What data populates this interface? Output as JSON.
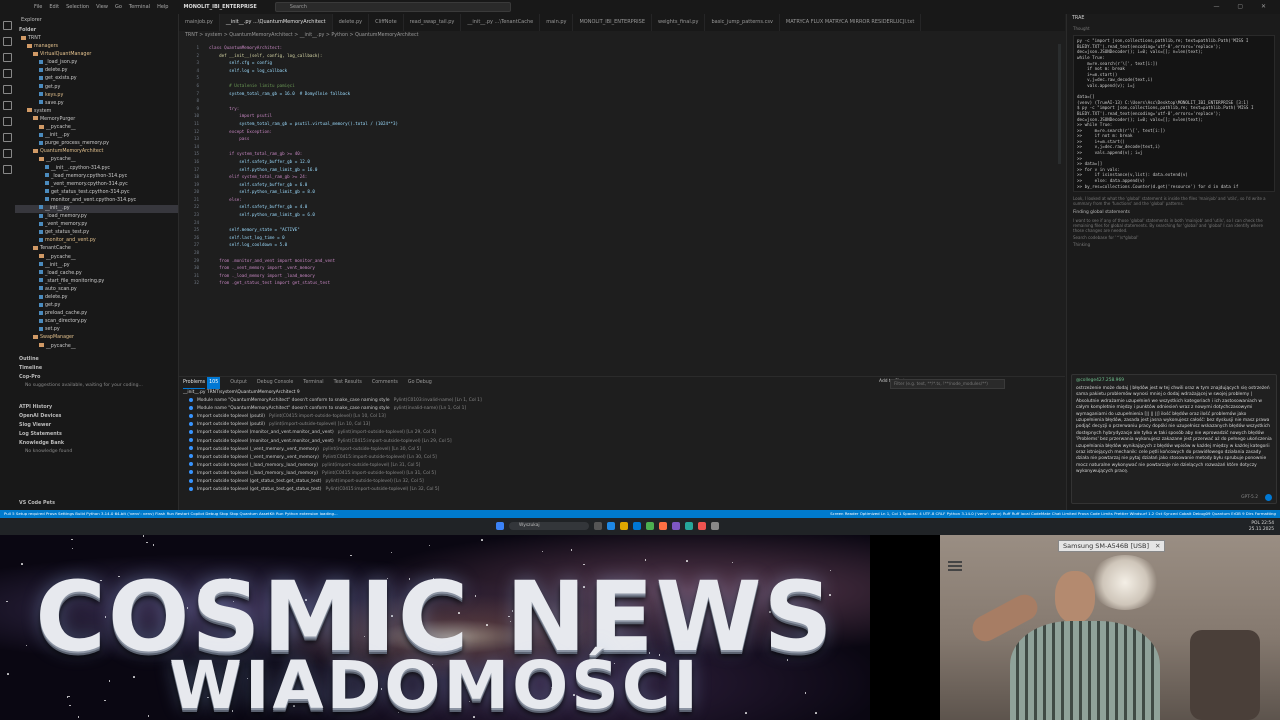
{
  "titlebar": {
    "menu": [
      "File",
      "Edit",
      "Selection",
      "View",
      "Go",
      "Terminal",
      "Help"
    ],
    "title": "MONOLIT_IBI_ENTERPRISE",
    "search_placeholder": "Search"
  },
  "sidebar": {
    "header": "Explorer",
    "folder_label": "Folder",
    "tree": [
      {
        "label": "TRNT",
        "kind": "folder",
        "depth": 0
      },
      {
        "label": "managers",
        "kind": "folder",
        "depth": 1,
        "mod": true
      },
      {
        "label": "VirtualQuantManager",
        "kind": "folder",
        "depth": 2,
        "mod": true
      },
      {
        "label": "_load_json.py",
        "kind": "file",
        "depth": 3
      },
      {
        "label": "delete.py",
        "kind": "file",
        "depth": 3
      },
      {
        "label": "get_exists.py",
        "kind": "file",
        "depth": 3
      },
      {
        "label": "get.py",
        "kind": "file",
        "depth": 3
      },
      {
        "label": "keys.py",
        "kind": "file",
        "depth": 3,
        "mod": true
      },
      {
        "label": "save.py",
        "kind": "file",
        "depth": 3
      },
      {
        "label": "system",
        "kind": "folder",
        "depth": 1
      },
      {
        "label": "MemoryPurger",
        "kind": "folder",
        "depth": 2
      },
      {
        "label": "__pycache__",
        "kind": "folder",
        "depth": 3
      },
      {
        "label": "__init__.py",
        "kind": "file",
        "depth": 3
      },
      {
        "label": "purge_process_memory.py",
        "kind": "file",
        "depth": 3
      },
      {
        "label": "QuantumMemoryArchitect",
        "kind": "folder",
        "depth": 2,
        "mod": true
      },
      {
        "label": "__pycache__",
        "kind": "folder",
        "depth": 3
      },
      {
        "label": "__init__.cpython-314.pyc",
        "kind": "file",
        "depth": 4
      },
      {
        "label": "_load_memory.cpython-314.pyc",
        "kind": "file",
        "depth": 4
      },
      {
        "label": "_vent_memory.cpython-314.pyc",
        "kind": "file",
        "depth": 4
      },
      {
        "label": "get_status_test.cpython-314.pyc",
        "kind": "file",
        "depth": 4
      },
      {
        "label": "monitor_and_vent.cpython-314.pyc",
        "kind": "file",
        "depth": 4
      },
      {
        "label": "__init__.py",
        "kind": "file",
        "depth": 3,
        "sel": true
      },
      {
        "label": "_load_memory.py",
        "kind": "file",
        "depth": 3
      },
      {
        "label": "_vent_memory.py",
        "kind": "file",
        "depth": 3
      },
      {
        "label": "get_status_test.py",
        "kind": "file",
        "depth": 3
      },
      {
        "label": "monitor_and_vent.py",
        "kind": "file",
        "depth": 3,
        "mod": true
      },
      {
        "label": "TenantCache",
        "kind": "folder",
        "depth": 2
      },
      {
        "label": "__pycache__",
        "kind": "folder",
        "depth": 3
      },
      {
        "label": "__init__.py",
        "kind": "file",
        "depth": 3
      },
      {
        "label": "_load_cache.py",
        "kind": "file",
        "depth": 3
      },
      {
        "label": "_start_file_monitoring.py",
        "kind": "file",
        "depth": 3
      },
      {
        "label": "auto_scan.py",
        "kind": "file",
        "depth": 3
      },
      {
        "label": "delete.py",
        "kind": "file",
        "depth": 3
      },
      {
        "label": "get.py",
        "kind": "file",
        "depth": 3
      },
      {
        "label": "preload_cache.py",
        "kind": "file",
        "depth": 3
      },
      {
        "label": "scan_directory.py",
        "kind": "file",
        "depth": 3
      },
      {
        "label": "set.py",
        "kind": "file",
        "depth": 3
      },
      {
        "label": "SwapManager",
        "kind": "folder",
        "depth": 2,
        "mod": true
      },
      {
        "label": "__pycache__",
        "kind": "folder",
        "depth": 3
      }
    ],
    "sections": {
      "outline": "Outline",
      "timeline": "Timeline",
      "copilot": "Cop-Pro",
      "copilot_msg": "No suggestions available, waiting for your coding...",
      "atpi_history": "ATPI History",
      "openai_devices": "OpenAI Devices",
      "slog_viewer": "Slog Viewer",
      "log_statements": "Log Statements",
      "knowledge_bank": "Knowledge Bank",
      "knowledge_msg": "No knowledge found",
      "code_pets": "VS Code Pets"
    }
  },
  "editor": {
    "tabs": [
      {
        "label": "mainjob.py",
        "active": false
      },
      {
        "label": "__init__.py   ...\\QuantumMemoryArchitect",
        "active": true
      },
      {
        "label": "delete.py",
        "active": false
      },
      {
        "label": "CliffNote",
        "active": false
      },
      {
        "label": "read_swap_tail.py",
        "active": false
      },
      {
        "label": "__init__.py   ...\\TenantCache",
        "active": false
      },
      {
        "label": "main.py",
        "active": false
      },
      {
        "label": "MONOLIT_IBI_ENTERPRISE",
        "active": false
      },
      {
        "label": "weights_final.py",
        "active": false
      },
      {
        "label": "basic_jump_patterns.csv",
        "active": false
      },
      {
        "label": "MATRYCA FLUX MATRYCA MIRROR RESIDERLUCJI.txt",
        "active": false
      }
    ],
    "breadcrumb": "TRNT > system > QuantumMemoryArchitect > __init__.py > Python > QuantumMemoryArchitect",
    "line_numbers": [
      "1",
      "2",
      "3",
      "4",
      "5",
      "6",
      "7",
      "8",
      "9",
      "10",
      "11",
      "12",
      "13",
      "14",
      "15",
      "16",
      "17",
      "18",
      "19",
      "20",
      "21",
      "22",
      "23",
      "24",
      "25",
      "26",
      "27",
      "28",
      "29",
      "30",
      "31",
      "32",
      "33",
      "34",
      "35",
      "36",
      "37"
    ],
    "code_lines": [
      {
        "text": "class QuantumMemoryArchitect:",
        "cls": "kw"
      },
      {
        "text": "    def __init__(self, config, log_callback):",
        "cls": "fn"
      },
      {
        "text": "        self.cfg = config",
        "cls": ""
      },
      {
        "text": "        self.log = log_callback",
        "cls": ""
      },
      {
        "text": "",
        "cls": ""
      },
      {
        "text": "        # Ustalenie limitu pamięci",
        "cls": "cm"
      },
      {
        "text": "        system_total_ram_gb = 16.0  # Domyślnie fallback",
        "cls": ""
      },
      {
        "text": "",
        "cls": ""
      },
      {
        "text": "        try:",
        "cls": "kw"
      },
      {
        "text": "            import psutil",
        "cls": "kw"
      },
      {
        "text": "            system_total_ram_gb = psutil.virtual_memory().total / (1024**3)",
        "cls": ""
      },
      {
        "text": "        except Exception:",
        "cls": "kw"
      },
      {
        "text": "            pass",
        "cls": "kw"
      },
      {
        "text": "",
        "cls": ""
      },
      {
        "text": "        if system_total_ram_gb >= 40:",
        "cls": "kw"
      },
      {
        "text": "            self.safety_buffer_gb = 12.0",
        "cls": ""
      },
      {
        "text": "            self.python_ram_limit_gb = 16.0",
        "cls": ""
      },
      {
        "text": "        elif system_total_ram_gb >= 24:",
        "cls": "kw"
      },
      {
        "text": "            self.safety_buffer_gb = 6.0",
        "cls": ""
      },
      {
        "text": "            self.python_ram_limit_gb = 8.0",
        "cls": ""
      },
      {
        "text": "        else:",
        "cls": "kw"
      },
      {
        "text": "            self.safety_buffer_gb = 4.0",
        "cls": ""
      },
      {
        "text": "            self.python_ram_limit_gb = 6.0",
        "cls": ""
      },
      {
        "text": "",
        "cls": ""
      },
      {
        "text": "        self.memory_state = \"ACTIVE\"",
        "cls": ""
      },
      {
        "text": "        self.last_log_time = 0",
        "cls": ""
      },
      {
        "text": "        self.log_cooldown = 5.0",
        "cls": ""
      },
      {
        "text": "",
        "cls": ""
      },
      {
        "text": "    from .monitor_and_vent import monitor_and_vent",
        "cls": "kw"
      },
      {
        "text": "    from ._vent_memory import _vent_memory",
        "cls": "kw"
      },
      {
        "text": "    from ._load_memory import _load_memory",
        "cls": "kw"
      },
      {
        "text": "    from .get_status_test import get_status_test",
        "cls": "kw"
      }
    ]
  },
  "panel": {
    "tabs": [
      "Problems",
      "Output",
      "Debug Console",
      "Terminal",
      "Test Results",
      "Comments",
      "Go Debug"
    ],
    "problems_count": "105",
    "add_to_chat": "Add to Chat",
    "filter_placeholder": "Filter (e.g. text, **/*.ts, !**/node_modules/**)",
    "rows": [
      {
        "kind": "file",
        "text": "__init__.py  TRNT\\system\\QuantumMemoryArchitect  9"
      },
      {
        "kind": "item",
        "text": "Module name \"QuantumMemoryArchitect\" doesn't conform to snake_case naming style",
        "src": "Pylint(C0103:invalid-name)  [Ln 1, Col 1]"
      },
      {
        "kind": "item",
        "text": "Module name \"QuantumMemoryArchitect\" doesn't conform to snake_case naming style",
        "src": "pylint(invalid-name)  [Ln 1, Col 1]"
      },
      {
        "kind": "item",
        "text": "Import outside toplevel (psutil)",
        "src": "Pylint(C0415:import-outside-toplevel)  [Ln 10, Col 13]"
      },
      {
        "kind": "item",
        "text": "Import outside toplevel (psutil)",
        "src": "pylint(import-outside-toplevel)  [Ln 10, Col 13]"
      },
      {
        "kind": "item",
        "text": "Import outside toplevel (monitor_and_vent.monitor_and_vent)",
        "src": "pylint(import-outside-toplevel)  [Ln 29, Col 5]"
      },
      {
        "kind": "item",
        "text": "Import outside toplevel (monitor_and_vent.monitor_and_vent)",
        "src": "Pylint(C0415:import-outside-toplevel)  [Ln 29, Col 5]"
      },
      {
        "kind": "item",
        "text": "Import outside toplevel (_vent_memory._vent_memory)",
        "src": "pylint(import-outside-toplevel)  [Ln 30, Col 5]"
      },
      {
        "kind": "item",
        "text": "Import outside toplevel (_vent_memory._vent_memory)",
        "src": "Pylint(C0415:import-outside-toplevel)  [Ln 30, Col 5]"
      },
      {
        "kind": "item",
        "text": "Import outside toplevel (_load_memory._load_memory)",
        "src": "pylint(import-outside-toplevel)  [Ln 31, Col 5]"
      },
      {
        "kind": "item",
        "text": "Import outside toplevel (_load_memory._load_memory)",
        "src": "Pylint(C0415:import-outside-toplevel)  [Ln 31, Col 5]"
      },
      {
        "kind": "item",
        "text": "Import outside toplevel (get_status_test.get_status_test)",
        "src": "pylint(import-outside-toplevel)  [Ln 32, Col 5]"
      },
      {
        "kind": "item",
        "text": "Import outside toplevel (get_status_test.get_status_test)",
        "src": "Pylint(C0415:import-outside-toplevel)  [Ln 32, Col 5]"
      }
    ]
  },
  "chat": {
    "header": "TRAE",
    "terminal_lines": [
      "py -c \"import json,collections,pathlib,re; text=pathlib.Path('MISS I",
      "BLEDY.TXT').read_text(encoding='utf-8',errors='replace');",
      "dec=json.JSONDecoder(); i=0; vals=[]; n=len(text);",
      "while True:",
      "    m=re.search(r'\\[', text[i:])",
      "    if not m: break",
      "    i+=m.start()",
      "    v,j=dec.raw_decode(text,i)",
      "    vals.append(v); i=j",
      "",
      "data=[]",
      "(venv) (TrueAI-13) C:\\Users\\Asc\\Desktop\\MONOLIT_IBI_ENTERPRISE [3:1]",
      "$ py -c \"import json,collections,pathlib,re; text=pathlib.Path('MISS I",
      "BLEDY.TXT').read_text(encoding='utf-8',errors='replace');",
      "dec=json.JSONDecoder(); i=0; vals=[]; n=len(text);",
      ">> while True:",
      ">>     m=re.search(r'\\[', text[i:])",
      ">>     if not m: break",
      ">>     i+=m.start()",
      ">>     v,j=dec.raw_decode(text,i)",
      ">>     vals.append(v); i=j",
      ">>",
      ">> data=[]",
      ">> for v in vals:",
      ">>     if isinstance(v,list): data.extend(v)",
      ">>     else: data.append(v)",
      ">> by_res=collections.Counter(d.get('resource') for d in data if"
    ],
    "thought_label": "Thought",
    "gray_note": "Look, I looked at what the 'global' statement is inside the files 'mainjob' and 'utils', so I'd write a summary from the 'functions' and the 'global' patterns.",
    "finding_label": "Finding global statements",
    "finding_note": "I want to see if any of those 'global' statements in both 'mainjob' and 'utils', so I can check the remaining files for global statements. By searching for 'global' and 'global' I can identify where those changes are needed.",
    "search_label": "Search codebase for '^\\s*global'",
    "thinking_label": "Thinking",
    "user_name": "@college427.258.969",
    "message": "ostrzeżenie może dodaj | błędów jest w tej chwili oraz w tym znajdujących się ostrzeżeń sama pakietu problemów wynosi mniej o dodaj wdrażającej w swojej problemy | Absolutnie wdrażamie uzupełnień we wszystkich kategoriach i ich zastosowaniach w całym kompletnie między i punktów odniesień wraz z nowymi dotychczasowymi wymaganiami do uzupełnienia [|| || ||] ilość błędów oraz ilość problemów jako uzupełnienia błędów, zasada jest jasna wykonujesz całość: bez dyskusji nie masz prawa podjąć decyzji o przerwaniu pracy dopóki nie uzupełnisz wskazanych błędów wszystkich dostępnych hybrydyzacje ale tylko w taki sposób aby nie wprowadzić nowych błędów 'Problems' bez przerwania wykonujesz zakazane jest przerwać aż do pełnego ukończenia uzupełniania błędów wynikających z błędów wpisów w każdej między w każdej kategorii oraz istniejących mechanik: cele pętli końcowych do prawidłowego działania zasady działa nie powtarzaj nie pytaj działań jako stosowanie metody byłu sprubuje ponownie mocz naturalne wykonywać nie powtarzaje nie dzielących rozważań które dotyczy wykonywujących pracę.",
    "model": "GPT-5.2"
  },
  "statusbar": {
    "left": "Pull 5  Setup required  Prova Settings  Build  Python 3.14.0 64-bit ('venv': venv)  Flash  Run  Restart Copilot  Debug  Stop  Stop  Quantum AssetKit  Run  Python extension loading...",
    "right": "Screen Reader Optimized  Ln 1, Col 1  Spaces: 4  UTF-8  CRLF  Python 3.14.0 ('venv': venv)  Ruff  Ruff  local  CodeMate  Chat Limited  Prova Code Limits  Prettier  Windsurf 1.2  Oct Synced  Cobalt  Debug09  Quantum  ErDB 9 Dirs  Formatting"
  },
  "taskbar": {
    "search_placeholder": "Wyszukaj",
    "lang": "POL",
    "time": "22:54",
    "date": "25.11.2025"
  },
  "cosmic": {
    "title": "COSMIC NEWS",
    "subtitle": "WIADOMOŚCI"
  },
  "webcam": {
    "device_label": "Samsung SM-A546B [USB]"
  }
}
